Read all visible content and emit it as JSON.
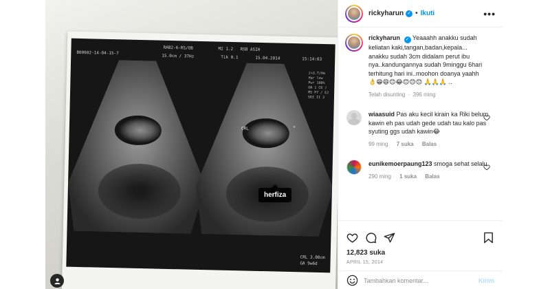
{
  "post": {
    "username": "rickyharun",
    "follow_label": "Ikuti",
    "more_label": "•••",
    "caption": "Yeaaahh anakku sudah keliatan kaki,tangan,badan,kepala... anakku sudah 3cm didalam perut ibu nya..kandungannya sudah 9minggu 6hari terhitung hari ini..moohon doanya yaahh 👌😁😄😊😂😊😊😊 🙏🙏🙏 ..",
    "caption_meta": {
      "status": "Telah disunting",
      "sep": "·",
      "age": "396 ming"
    },
    "likes": "12,823 suka",
    "date": "APRIL 15, 2014",
    "comment_placeholder": "Tambahkan komentar...",
    "post_button": "Kirim"
  },
  "comments": [
    {
      "username": "wiaasuid",
      "text": "Pas aku kecil kirain ka Riki belum kawin eh pas udah gede udah tau kalo pas syuting ggs udah kawin😂",
      "age": "99 ming",
      "likes": "7 suka",
      "reply": "Balas"
    },
    {
      "username": "eunikemoerpaung123",
      "text": "smoga sehat selalu",
      "age": "290 ming",
      "likes": "1 suka",
      "reply": "Balas"
    }
  ],
  "photo": {
    "tag_label": "herfiza",
    "scan_header": {
      "patient_id": "B00602-14-04-15-7",
      "probe": "RAB2-6-RS/OB",
      "index": "MI 1.2",
      "tis": "RSB ASIH",
      "depth": "15.0cm / 37Hz",
      "tik": "Tik 0.1",
      "date": "15.04.2014",
      "time": "15:14:03"
    },
    "scan_side": "2+3.T/Hm Har low Pwr 100% GN 1 C6 / M5 P7 / E2 SRI II 3",
    "measure_crl": "CRL   3.00cm",
    "measure_ga": "GA      9w6d",
    "marker_crl": "CRL",
    "marker_x": "+"
  },
  "colors": {
    "link_blue": "#0095f6",
    "meta_gray": "#8e8e8e",
    "text": "#262626"
  },
  "icons": [
    "heart-icon",
    "comment-icon",
    "share-icon",
    "bookmark-icon",
    "emoji-icon",
    "user-tag-icon",
    "verified-icon"
  ]
}
